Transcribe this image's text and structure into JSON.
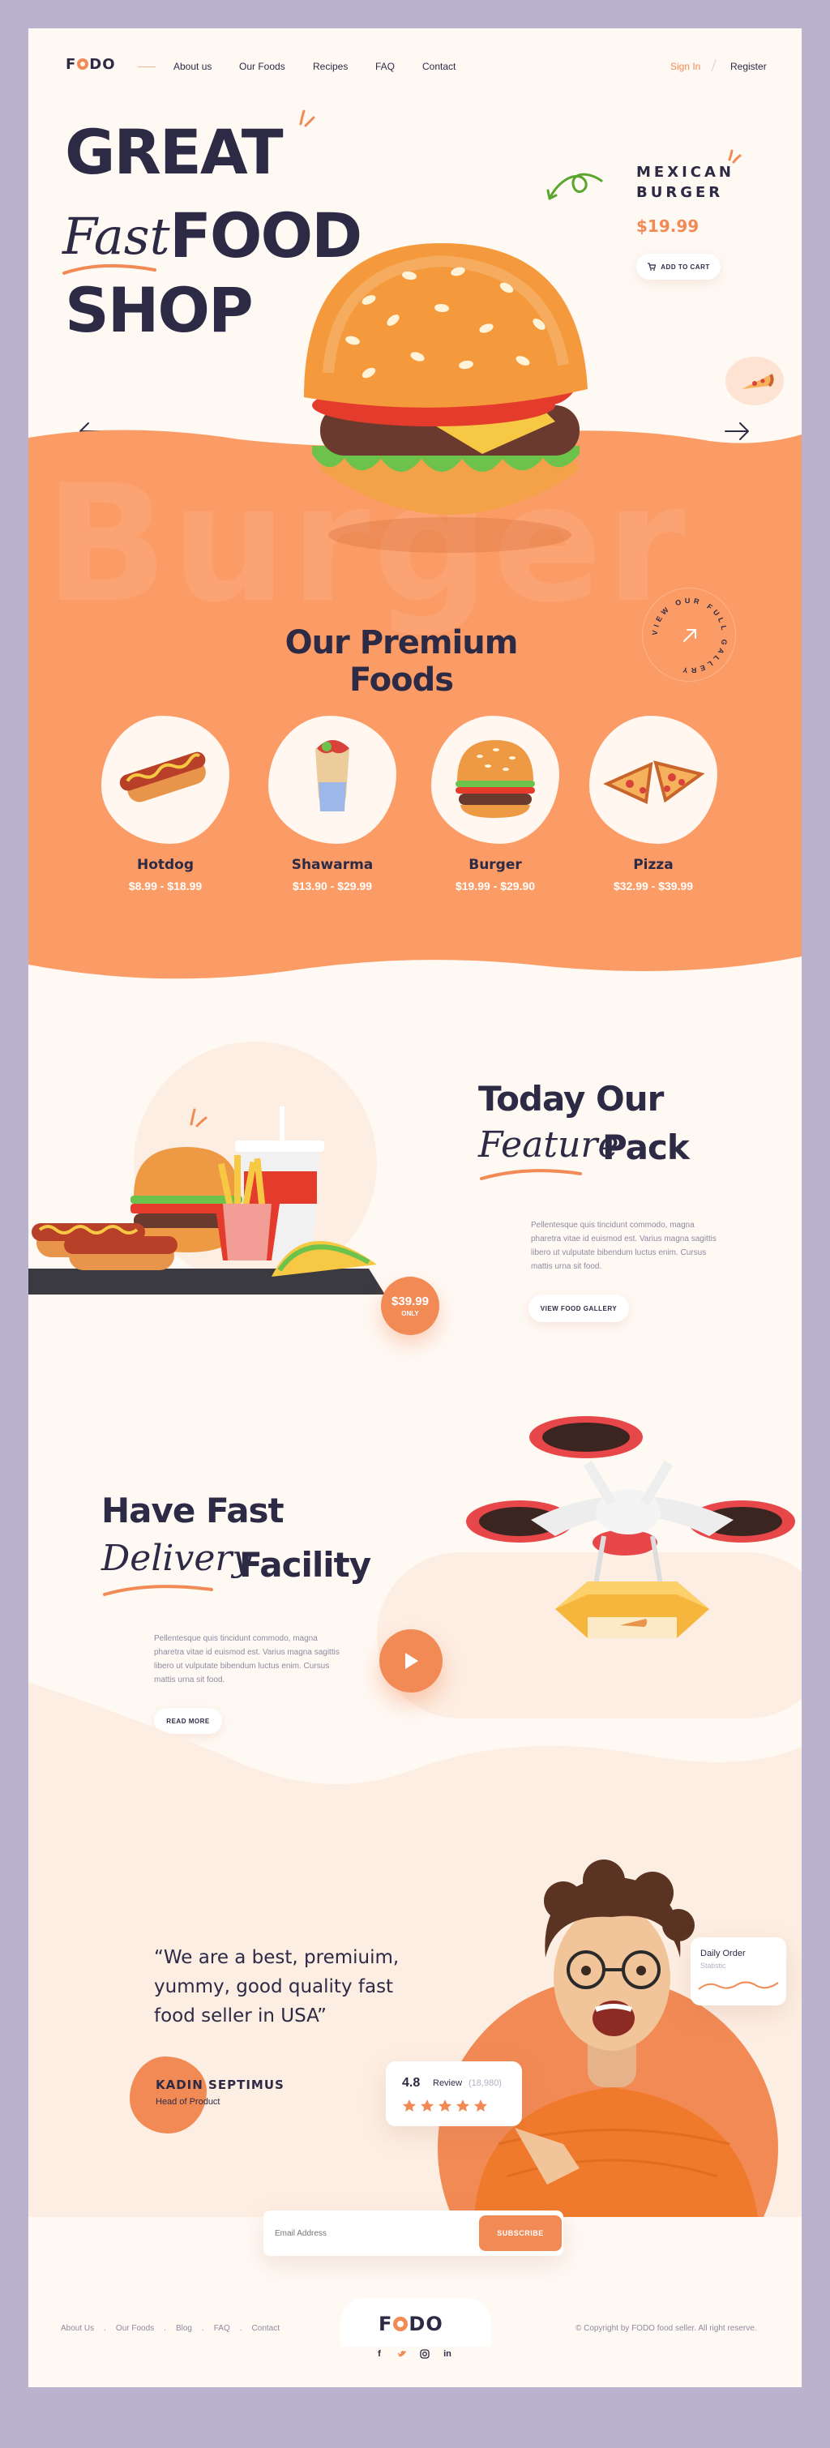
{
  "nav": {
    "logo": "FODO",
    "links": [
      "About us",
      "Our Foods",
      "Recipes",
      "FAQ",
      "Contact"
    ],
    "sign_in": "Sign In",
    "register": "Register"
  },
  "hero": {
    "line1": "GREAT",
    "line2_script": "Fast",
    "line2": "FOOD",
    "line3": "SHOP",
    "product_line1": "MEXICAN",
    "product_line2": "BURGER",
    "product_price": "$19.99",
    "add_to_cart": "ADD TO CART",
    "bg_word": "Burger",
    "rotating_badge": "VIEW OUR FULL GALLERY"
  },
  "premium": {
    "title": "Our Premium Foods",
    "items": [
      {
        "name": "Hotdog",
        "price": "$8.99 - $18.99"
      },
      {
        "name": "Shawarma",
        "price": "$13.90 - $29.99"
      },
      {
        "name": "Burger",
        "price": "$19.99 - $29.90"
      },
      {
        "name": "Pizza",
        "price": "$32.99 - $39.99"
      }
    ]
  },
  "feature": {
    "title1": "Today Our",
    "title_script": "Feature",
    "title2": "Pack",
    "text": "Pellentesque quis tincidunt commodo, magna pharetra vitae id euismod est. Varius magna sagittis libero ut vulputate bibendum luctus enim. Cursus mattis urna sit food.",
    "button": "VIEW FOOD GALLERY",
    "badge_price": "$39.99",
    "badge_label": "ONLY"
  },
  "delivery": {
    "title1": "Have Fast",
    "title_script": "Delivery",
    "title2": "Facility",
    "text": "Pellentesque quis tincidunt commodo, magna pharetra vitae id euismod est. Varius magna sagittis libero ut vulputate bibendum luctus enim. Cursus mattis urna sit food.",
    "button": "READ MORE"
  },
  "testimonial": {
    "quote_line1": "“We are a best, premiuim,",
    "quote_line2": "yummy, good quality fast",
    "quote_line3": "food seller in USA”",
    "author": "KADIN SEPTIMUS",
    "role": "Head of Product",
    "rating": "4.8",
    "review_label": "Review",
    "review_count": "(18,980)",
    "stars": 5,
    "daily_title": "Daily Order",
    "daily_sub": "Statistic"
  },
  "subscribe": {
    "placeholder": "Email Address",
    "button": "SUBSCRIBE"
  },
  "footer": {
    "links": [
      "About Us",
      "Our Foods",
      "Blog",
      "FAQ",
      "Contact"
    ],
    "logo": "FODO",
    "copyright": "© Copyright by FODO food seller. All right reserve.",
    "socials": [
      "facebook-icon",
      "twitter-icon",
      "instagram-icon",
      "linkedin-icon"
    ]
  },
  "colors": {
    "accent": "#f28a55",
    "dark": "#2d2a45",
    "band": "#fb9c67",
    "cream": "#fff9f4"
  }
}
